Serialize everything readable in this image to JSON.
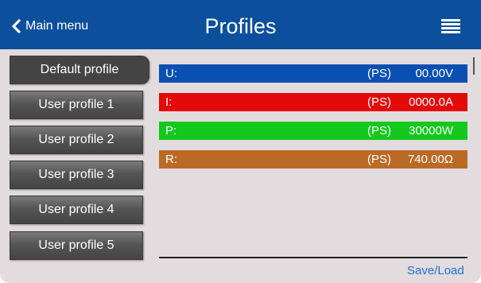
{
  "header": {
    "back_label": "Main menu",
    "title": "Profiles",
    "menu_icon": "hamburger-menu-icon",
    "back_icon": "chevron-left-icon",
    "bg_color": "#0c4f9c"
  },
  "profiles": [
    {
      "label": "Default profile",
      "active": true
    },
    {
      "label": "User profile 1",
      "active": false
    },
    {
      "label": "User profile 2",
      "active": false
    },
    {
      "label": "User profile 3",
      "active": false
    },
    {
      "label": "User profile 4",
      "active": false
    },
    {
      "label": "User profile 5",
      "active": false
    }
  ],
  "values": [
    {
      "label": "U:",
      "mode": "(PS)",
      "value": "00.00V",
      "color": "#0b4fb3"
    },
    {
      "label": "I:",
      "mode": "(PS)",
      "value": "0000.0A",
      "color": "#e40a0a"
    },
    {
      "label": "P:",
      "mode": "(PS)",
      "value": "30000W",
      "color": "#14c81e"
    },
    {
      "label": "R:",
      "mode": "(PS)",
      "value": "740.00Ω",
      "color": "#bb6a25"
    }
  ],
  "footer": {
    "action_label": "Save/Load"
  }
}
